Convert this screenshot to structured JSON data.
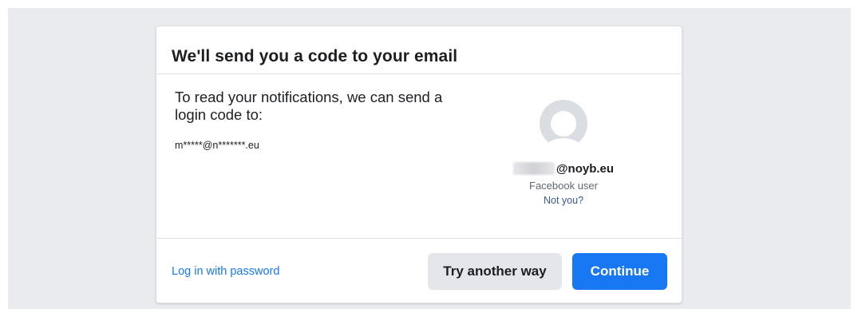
{
  "dialog": {
    "title": "We'll send you a code to your email",
    "body_text": "To read your notifications, we can send a login code to:",
    "masked_email": "m*****@n*******.eu"
  },
  "profile": {
    "email_suffix": "@noyb.eu",
    "subtitle": "Facebook user",
    "not_you_label": "Not you?"
  },
  "footer": {
    "login_password_label": "Log in with password",
    "try_another_label": "Try another way",
    "continue_label": "Continue"
  },
  "icons": {
    "avatar": "default-profile-avatar-icon"
  },
  "colors": {
    "page_background": "#e9ebee",
    "primary": "#1877f2",
    "secondary_button": "#e4e6eb",
    "link": "#385898",
    "text": "#1c1e21",
    "muted_text": "#606770"
  }
}
